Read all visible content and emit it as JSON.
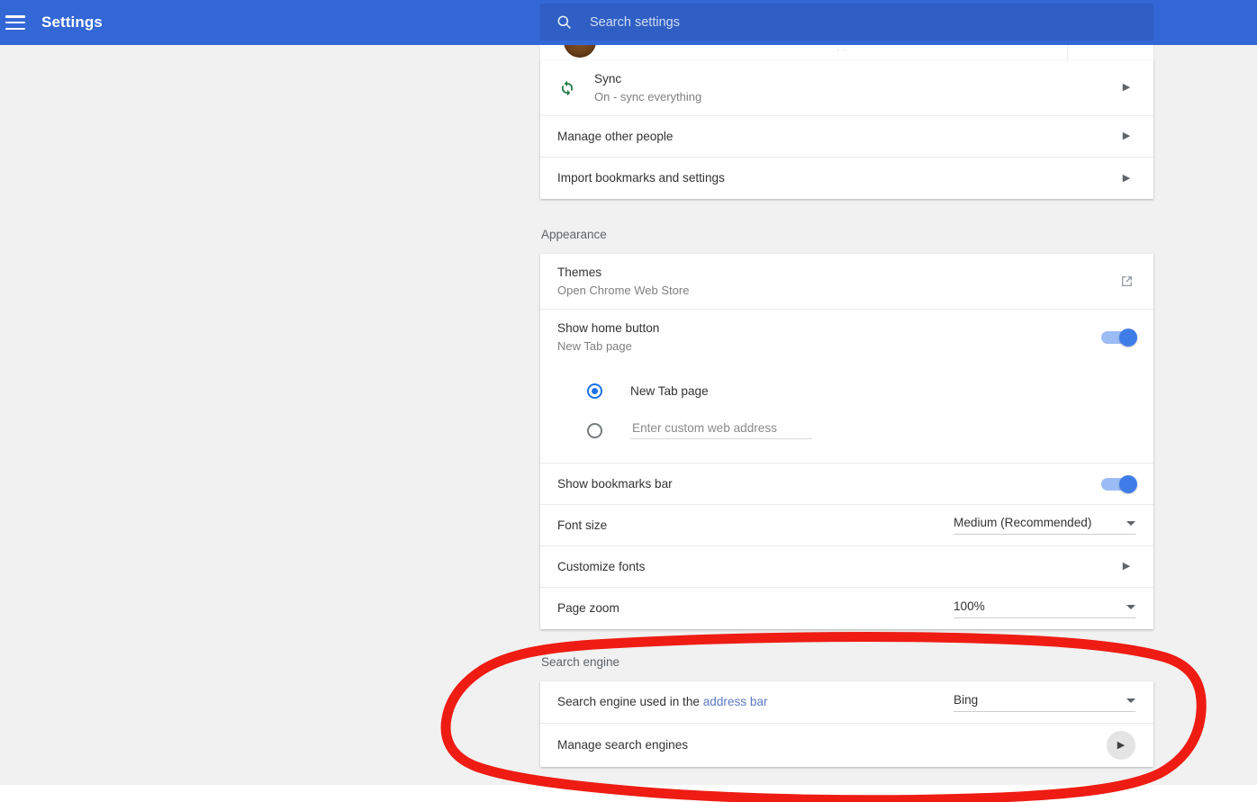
{
  "topbar": {
    "menu_icon": "hamburger-icon",
    "title": "Settings",
    "search_icon": "search-icon",
    "search_placeholder": "Search settings",
    "background_color": "#3367d6",
    "search_background_color": "#2f5fc4"
  },
  "people_card": {
    "rows": [
      {
        "icon": "sync-icon",
        "title": "Sync",
        "subtitle": "On - sync everything",
        "control": "chevron-right-icon"
      },
      {
        "title": "Manage other people",
        "control": "chevron-right-icon"
      },
      {
        "title": "Import bookmarks and settings",
        "control": "chevron-right-icon"
      }
    ]
  },
  "appearance": {
    "section_label": "Appearance",
    "themes": {
      "title": "Themes",
      "subtitle": "Open Chrome Web Store",
      "control": "open-in-new-icon"
    },
    "show_home_button": {
      "title": "Show home button",
      "subtitle": "New Tab page",
      "toggle_on": true
    },
    "home_options": [
      {
        "label": "New Tab page",
        "selected": true
      },
      {
        "label": "",
        "placeholder": "Enter custom web address",
        "value": "",
        "selected": false
      }
    ],
    "show_bookmarks_bar": {
      "title": "Show bookmarks bar",
      "toggle_on": true
    },
    "font_size": {
      "title": "Font size",
      "value": "Medium (Recommended)"
    },
    "customize_fonts": {
      "title": "Customize fonts",
      "control": "chevron-right-icon"
    },
    "page_zoom": {
      "title": "Page zoom",
      "value": "100%"
    }
  },
  "search_engine": {
    "section_label": "Search engine",
    "address_bar_row": {
      "title_prefix": "Search engine used in the ",
      "title_link": "address bar",
      "value": "Bing"
    },
    "manage_row": {
      "title": "Manage search engines",
      "control": "chevron-right-icon"
    }
  },
  "annotation": {
    "shape": "hand-drawn-oval",
    "color": "#ee1c13",
    "stroke_width": 11
  },
  "colors": {
    "page_background": "#f1f1f1",
    "card_background": "#ffffff",
    "accent_blue": "#3f7ce8",
    "link_blue": "#5b79c6",
    "sync_green": "#1e7a44",
    "primary_text": "#333333",
    "secondary_text": "#808080"
  }
}
